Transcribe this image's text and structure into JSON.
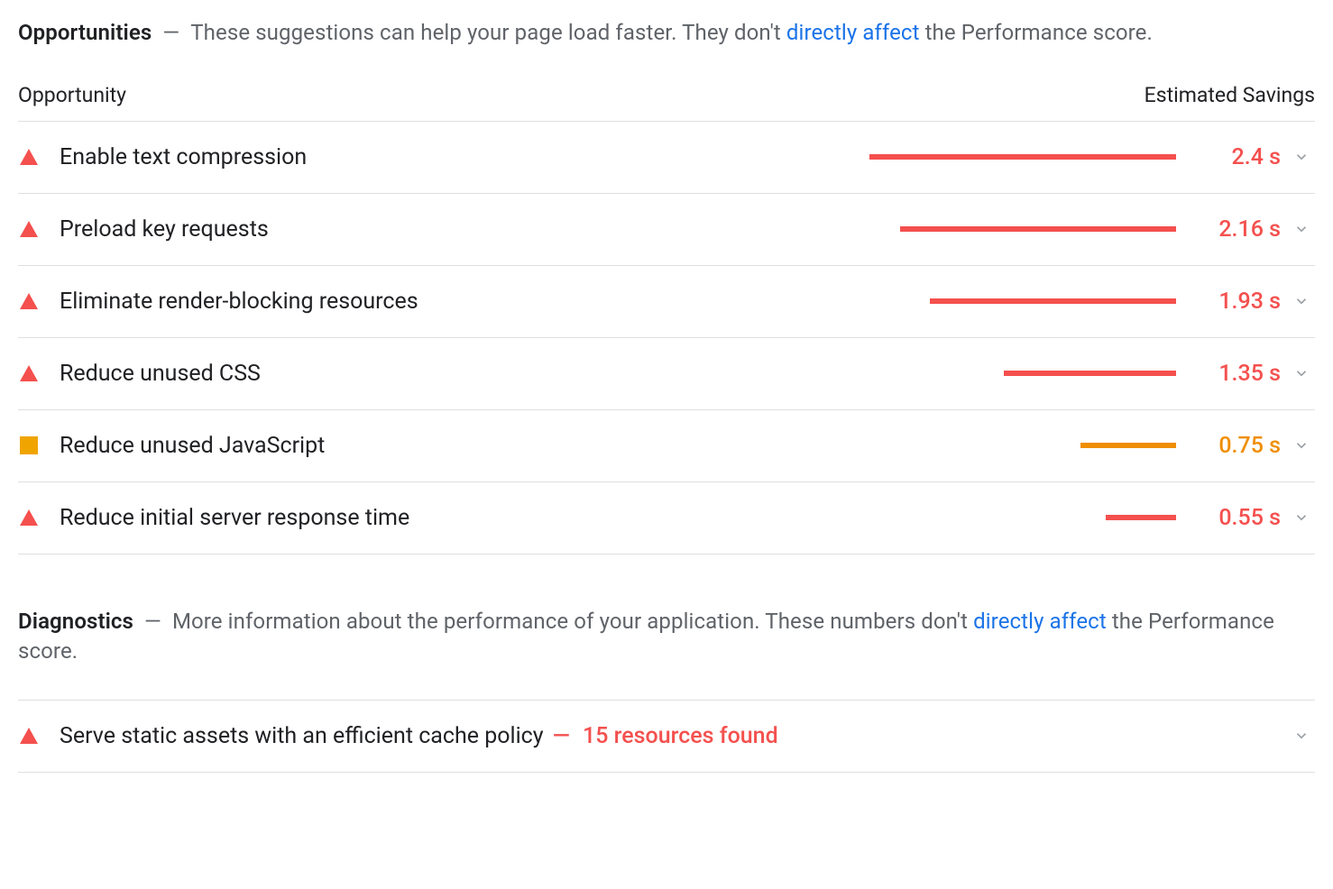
{
  "opportunities": {
    "title": "Opportunities",
    "dash": " — ",
    "lead_1": "These suggestions can help your page load faster. They don't ",
    "link": "directly affect",
    "lead_2": " the Performance score.",
    "col_left": "Opportunity",
    "col_right": "Estimated Savings",
    "bar_max": 2.4,
    "items": [
      {
        "severity": "fail",
        "label": "Enable text compression",
        "savings": "2.4 s",
        "value": 2.4,
        "color": "red"
      },
      {
        "severity": "fail",
        "label": "Preload key requests",
        "savings": "2.16 s",
        "value": 2.16,
        "color": "red"
      },
      {
        "severity": "fail",
        "label": "Eliminate render-blocking resources",
        "savings": "1.93 s",
        "value": 1.93,
        "color": "red"
      },
      {
        "severity": "fail",
        "label": "Reduce unused CSS",
        "savings": "1.35 s",
        "value": 1.35,
        "color": "red"
      },
      {
        "severity": "avg",
        "label": "Reduce unused JavaScript",
        "savings": "0.75 s",
        "value": 0.75,
        "color": "orange"
      },
      {
        "severity": "fail",
        "label": "Reduce initial server response time",
        "savings": "0.55 s",
        "value": 0.55,
        "color": "red"
      }
    ]
  },
  "diagnostics": {
    "title": "Diagnostics",
    "dash": " — ",
    "lead_1": "More information about the performance of your application. These numbers don't ",
    "link": "directly affect",
    "lead_2": " the Performance score.",
    "items": [
      {
        "severity": "fail",
        "label": "Serve static assets with an efficient cache policy",
        "extra_dash": "—",
        "extra": "15 resources found"
      }
    ]
  }
}
